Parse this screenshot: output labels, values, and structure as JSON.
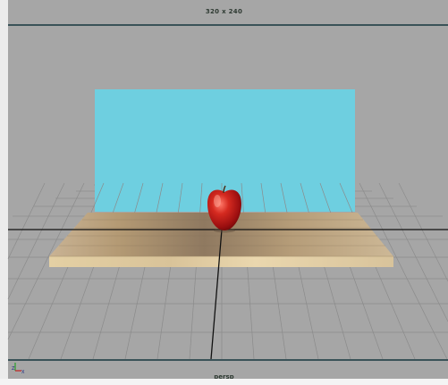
{
  "viewport": {
    "resolution_gate_label": "320 x 240",
    "camera_name": "persp",
    "axis_indicator": {
      "icon": "axis-indicator-icon",
      "z_label": "Z",
      "x_label": "X"
    }
  },
  "scene": {
    "backdrop": {
      "color": "#6ecfe0"
    },
    "table_top": {
      "color": "#b79c78"
    },
    "apple": {
      "color": "#c51818"
    },
    "grid_color": "#8e8e8e",
    "axis_color": "#111111"
  }
}
